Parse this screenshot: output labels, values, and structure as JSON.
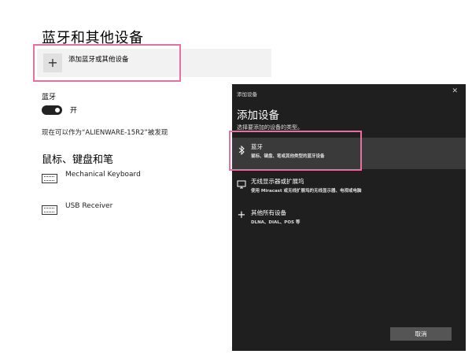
{
  "settings": {
    "title": "蓝牙和其他设备",
    "add_device_label": "添加蓝牙或其他设备",
    "add_icon": "plus-icon",
    "bluetooth_header": "蓝牙",
    "toggle_state": "开",
    "discoverable_text": "现在可以作为“ALIENWARE-15R2”被发现",
    "section_title": "鼠标、键盘和笔",
    "devices": [
      {
        "name": "Mechanical Keyboard",
        "icon": "keyboard-icon"
      },
      {
        "name": "USB Receiver",
        "icon": "keyboard-icon"
      }
    ]
  },
  "dialog": {
    "caption": "添加设备",
    "close_icon": "close-icon",
    "close_glyph": "✕",
    "title": "添加设备",
    "subtitle": "选择要添加的设备的类型。",
    "options": [
      {
        "title": "蓝牙",
        "desc": "鼠标、键盘、笔或其他类型的蓝牙设备",
        "icon": "bluetooth-icon"
      },
      {
        "title": "无线显示器或扩展坞",
        "desc": "使用 Miracast 或无线扩展坞的无线显示器、电视或电脑",
        "icon": "monitor-icon"
      },
      {
        "title": "其他所有设备",
        "desc": "DLNA、DIAL、POS 等",
        "icon": "plus-icon"
      }
    ],
    "cancel_label": "取消"
  },
  "colors": {
    "highlight": "#e86fa4",
    "dialog_bg": "#1f1f1f",
    "selected_bg": "#3a3a3a"
  }
}
